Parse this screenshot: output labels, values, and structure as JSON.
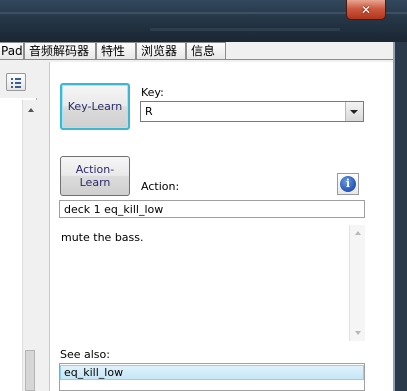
{
  "window": {
    "close_symbol": "✕",
    "close_icon": "close-icon"
  },
  "tabs": [
    {
      "label": "Pad"
    },
    {
      "label": "音频解码器"
    },
    {
      "label": "特性"
    },
    {
      "label": "浏览器"
    },
    {
      "label": "信息"
    }
  ],
  "left_panel": {
    "view_icon": "list-view-icon",
    "scroll_icon": "scroll-up-icon"
  },
  "mapping": {
    "key_learn_label": "Key-Learn",
    "key_label": "Key:",
    "key_value": "R",
    "action_learn_label": "Action-Learn",
    "action_label": "Action:",
    "info_icon": "info-icon",
    "info_symbol": "i",
    "action_value": "deck 1 eq_kill_low",
    "description": "mute the bass.",
    "see_also_label": "See also:",
    "see_also_items": [
      "eq_kill_low"
    ]
  },
  "colors": {
    "close_red": "#c6452c",
    "focus_cyan": "#3cb6d4",
    "selection": "#c6e6f6",
    "info_blue": "#2a5dbd"
  }
}
